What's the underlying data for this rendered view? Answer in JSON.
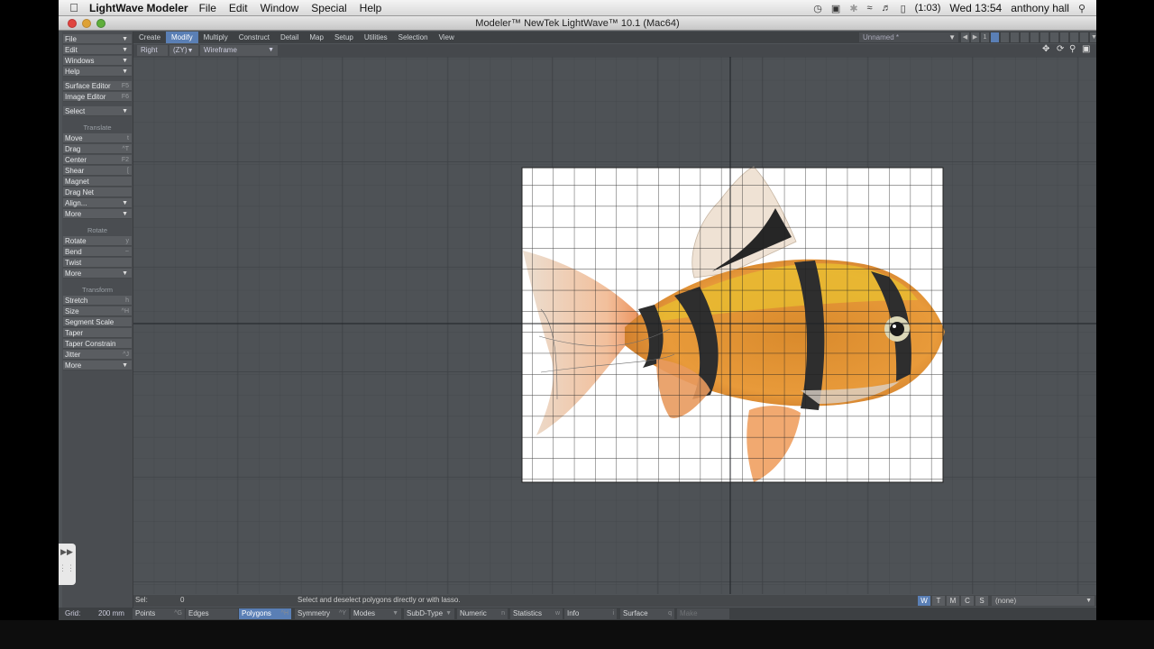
{
  "menubar": {
    "app_name": "LightWave Modeler",
    "menus": [
      "File",
      "Edit",
      "Window",
      "Special",
      "Help"
    ],
    "battery": "(1:03)",
    "clock": "Wed 13:54",
    "user": "anthony hall"
  },
  "window": {
    "title": "Modeler™ NewTek LightWave™ 10.1 (Mac64)"
  },
  "tabs": [
    "Create",
    "Modify",
    "Multiply",
    "Construct",
    "Detail",
    "Map",
    "Setup",
    "Utilities",
    "Selection",
    "View"
  ],
  "active_tab": "Modify",
  "object_name": "Unnamed *",
  "layer_number": "1",
  "viewport": {
    "view": "Right",
    "axes": "(ZY)",
    "mode": "Wireframe"
  },
  "left_panel": {
    "menus": [
      {
        "label": "File"
      },
      {
        "label": "Edit"
      },
      {
        "label": "Windows"
      },
      {
        "label": "Help"
      }
    ],
    "editors": [
      {
        "label": "Surface Editor",
        "key": "F5"
      },
      {
        "label": "Image Editor",
        "key": "F6"
      }
    ],
    "select": "Select",
    "translate": {
      "heading": "Translate",
      "items": [
        {
          "label": "Move",
          "key": "t"
        },
        {
          "label": "Drag",
          "key": "^T"
        },
        {
          "label": "Center",
          "key": "F2"
        },
        {
          "label": "Shear",
          "key": "["
        },
        {
          "label": "Magnet",
          "key": ""
        },
        {
          "label": "Drag Net",
          "key": ""
        },
        {
          "label": "Align...",
          "key": ""
        },
        {
          "label": "More",
          "key": ""
        }
      ]
    },
    "rotate": {
      "heading": "Rotate",
      "items": [
        {
          "label": "Rotate",
          "key": "y"
        },
        {
          "label": "Bend",
          "key": "~"
        },
        {
          "label": "Twist",
          "key": ""
        },
        {
          "label": "More",
          "key": ""
        }
      ]
    },
    "transform": {
      "heading": "Transform",
      "items": [
        {
          "label": "Stretch",
          "key": "h"
        },
        {
          "label": "Size",
          "key": "^H"
        },
        {
          "label": "Segment Scale",
          "key": ""
        },
        {
          "label": "Taper",
          "key": ""
        },
        {
          "label": "Taper Constrain",
          "key": ""
        },
        {
          "label": "Jitter",
          "key": "^J"
        },
        {
          "label": "More",
          "key": ""
        }
      ]
    }
  },
  "status": {
    "sel_label": "Sel:",
    "sel_value": "0",
    "hint": "Select and deselect polygons directly or with lasso.",
    "wtmcs": [
      "W",
      "T",
      "M",
      "C",
      "S"
    ],
    "surface_dropdown": "(none)",
    "grid_label": "Grid:",
    "grid_value": "200 mm",
    "points": "Points",
    "points_key": "^G",
    "edges": "Edges",
    "polygons": "Polygons",
    "polygons_key": "^H",
    "symmetry": "Symmetry",
    "symmetry_key": "^Y",
    "modes": "Modes",
    "subd_type": "SubD-Type",
    "numeric": "Numeric",
    "numeric_key": "n",
    "statistics": "Statistics",
    "statistics_key": "w",
    "info": "Info",
    "info_key": "i",
    "surface": "Surface",
    "surface_key": "q",
    "make": "Make"
  }
}
